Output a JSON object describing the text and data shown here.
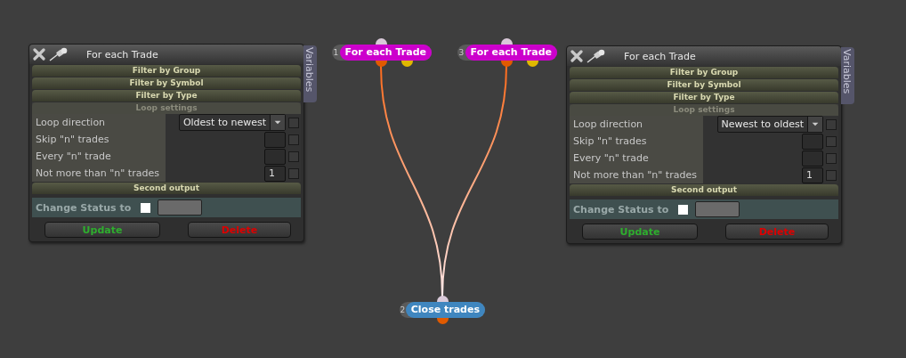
{
  "panels": [
    {
      "title": "For each Trade",
      "side_tab": "Variables",
      "sections": [
        "Filter by Group",
        "Filter by Symbol",
        "Filter by Type"
      ],
      "loop_settings": {
        "header": "Loop settings",
        "rows": [
          {
            "label": "Loop direction",
            "kind": "select",
            "value": "Oldest to newest",
            "checked": false
          },
          {
            "label": "Skip \"n\" trades",
            "kind": "number",
            "checked": false
          },
          {
            "label": "Every \"n\" trade",
            "kind": "number",
            "checked": false
          },
          {
            "label": "Not more than \"n\" trades",
            "kind": "number",
            "value": "1",
            "checked": false
          }
        ]
      },
      "second_output": "Second output",
      "status": {
        "label": "Change Status to",
        "checked": false
      },
      "buttons": [
        {
          "label": "Update",
          "kind": "update"
        },
        {
          "label": "Delete",
          "kind": "delete"
        }
      ]
    },
    {
      "title": "For each Trade",
      "side_tab": "Variables",
      "sections": [
        "Filter by Group",
        "Filter by Symbol",
        "Filter by Type"
      ],
      "loop_settings": {
        "header": "Loop settings",
        "rows": [
          {
            "label": "Loop direction",
            "kind": "select",
            "value": "Newest to oldest",
            "checked": false
          },
          {
            "label": "Skip \"n\" trades",
            "kind": "number",
            "checked": false
          },
          {
            "label": "Every \"n\" trade",
            "kind": "number",
            "checked": false
          },
          {
            "label": "Not more than \"n\" trades",
            "kind": "number",
            "value": "1",
            "checked": false
          }
        ]
      },
      "second_output": "Second output",
      "status": {
        "label": "Change Status to",
        "checked": false
      },
      "buttons": [
        {
          "label": "Update",
          "kind": "update"
        },
        {
          "label": "Delete",
          "kind": "delete"
        }
      ]
    }
  ],
  "nodes": [
    {
      "number": "1",
      "label": "For each Trade",
      "color": "#cc00cc"
    },
    {
      "number": "3",
      "label": "For each Trade",
      "color": "#cc00cc"
    },
    {
      "number": "2",
      "label": "Close trades",
      "color": "#3f86bf"
    }
  ]
}
